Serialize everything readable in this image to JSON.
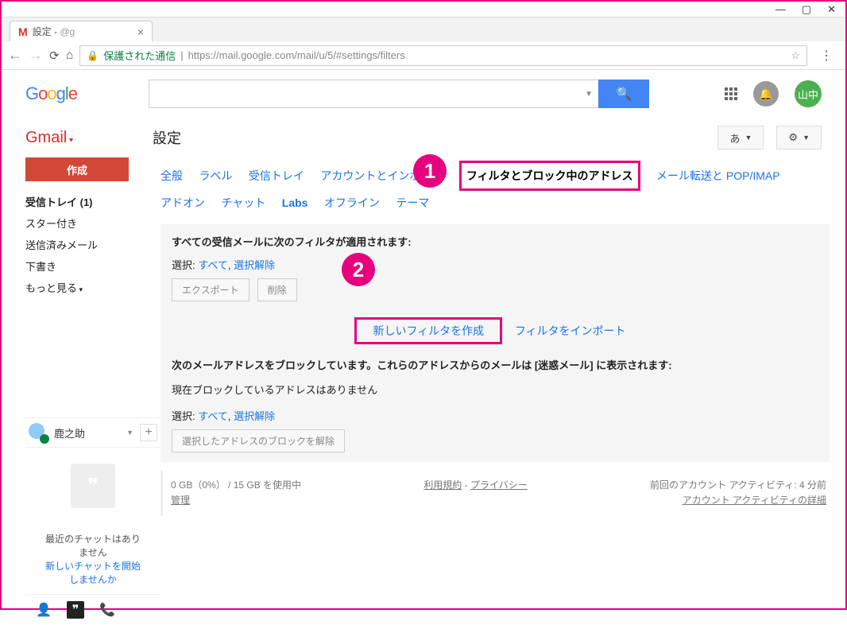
{
  "window": {
    "min": "—",
    "max": "▢",
    "close": "✕"
  },
  "tab": {
    "prefix": "設定 - ",
    "email": "@g",
    "close": "×"
  },
  "addr": {
    "secure": "保護された通信",
    "url": "https://mail.google.com/mail/u/5/#settings/filters"
  },
  "logo": {
    "g1": "G",
    "o1": "o",
    "o2": "o",
    "g2": "g",
    "l": "l",
    "e": "e"
  },
  "search": {
    "placeholder": "",
    "btn": "🔍"
  },
  "avatar": "山中",
  "gmail_label": "Gmail",
  "page_title": "設定",
  "lang_btn": "あ",
  "compose": "作成",
  "nav": [
    "受信トレイ (1)",
    "スター付き",
    "送信済みメール",
    "下書き",
    "もっと見る"
  ],
  "person": "鹿之助",
  "chat_empty": {
    "line1": "最近のチャットはあり",
    "line2": "ません",
    "link1": "新しいチャットを開始",
    "link2": "しませんか"
  },
  "tabs": [
    "全般",
    "ラベル",
    "受信トレイ",
    "アカウントとインポート",
    "フィルタとブロック中のアドレス",
    "メール転送と POP/IMAP",
    "アドオン",
    "チャット",
    "Labs",
    "オフライン",
    "テーマ"
  ],
  "panel1": {
    "title": "すべての受信メールに次のフィルタが適用されます:",
    "sel": "選択:",
    "all": "すべて",
    "none": "選択解除",
    "export": "エクスポート",
    "delete": "削除",
    "new_filter": "新しいフィルタを作成",
    "import": "フィルタをインポート"
  },
  "panel2": {
    "title": "次のメールアドレスをブロックしています。これらのアドレスからのメールは [迷惑メール] に表示されます:",
    "none_blocked": "現在ブロックしているアドレスはありません",
    "sel": "選択:",
    "all": "すべて",
    "none_sel": "選択解除",
    "unblock": "選択したアドレスのブロックを解除"
  },
  "footer": {
    "storage": "0 GB（0%） / 15 GB を使用中",
    "manage": "管理",
    "terms": "利用規約",
    "dash": " - ",
    "privacy": "プライバシー",
    "activity1": "前回のアカウント アクティビティ: 4 分前",
    "activity2": "アカウント アクティビティの詳細"
  },
  "markers": {
    "1": "1",
    "2": "2"
  }
}
